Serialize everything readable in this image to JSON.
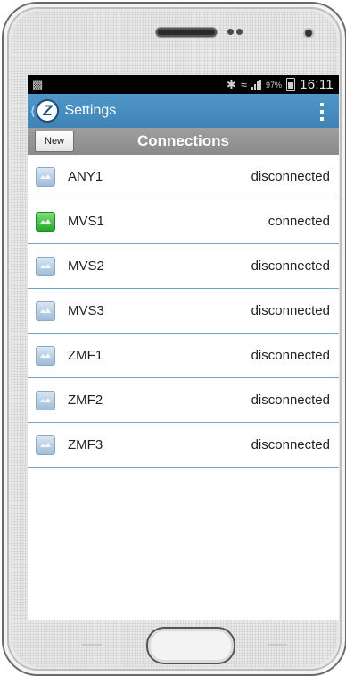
{
  "status_bar": {
    "battery_percent": "97%",
    "time": "16:11",
    "icons": [
      "notification-icon",
      "bluetooth-icon",
      "wifi-icon",
      "signal-icon",
      "battery-icon"
    ]
  },
  "action_bar": {
    "logo_letter": "Z",
    "title": "Settings"
  },
  "toolbar": {
    "new_label": "New",
    "title": "Connections"
  },
  "connections": [
    {
      "name": "ANY1",
      "status": "disconnected",
      "connected": false
    },
    {
      "name": "MVS1",
      "status": "connected",
      "connected": true
    },
    {
      "name": "MVS2",
      "status": "disconnected",
      "connected": false
    },
    {
      "name": "MVS3",
      "status": "disconnected",
      "connected": false
    },
    {
      "name": "ZMF1",
      "status": "disconnected",
      "connected": false
    },
    {
      "name": "ZMF2",
      "status": "disconnected",
      "connected": false
    },
    {
      "name": "ZMF3",
      "status": "disconnected",
      "connected": false
    }
  ],
  "colors": {
    "action_bar": "#4a90c2",
    "toolbar": "#939393",
    "connected_icon": "#3cc43f",
    "disconnected_icon": "#b5cbe0",
    "row_divider": "#6aa7cc"
  }
}
